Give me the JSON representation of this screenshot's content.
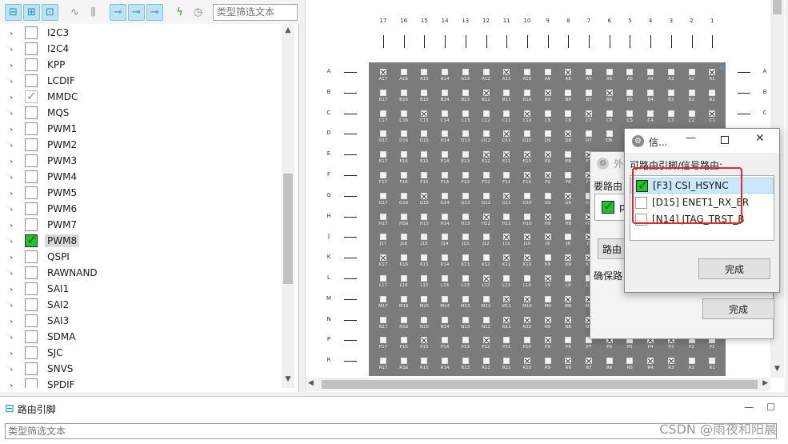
{
  "toolbar": {
    "filter_placeholder": "类型筛选文本",
    "icons": [
      "align-left-icon",
      "align-center-icon",
      "align-right-icon",
      "wave-icon",
      "signal-icon",
      "route-icon",
      "route-forward-icon",
      "route-next-icon",
      "bolt-icon",
      "clock-icon"
    ]
  },
  "peripherals": [
    {
      "label": "I2C3",
      "state": "none"
    },
    {
      "label": "I2C4",
      "state": "none"
    },
    {
      "label": "KPP",
      "state": "none"
    },
    {
      "label": "LCDIF",
      "state": "none"
    },
    {
      "label": "MMDC",
      "state": "gray"
    },
    {
      "label": "MQS",
      "state": "none"
    },
    {
      "label": "PWM1",
      "state": "none"
    },
    {
      "label": "PWM2",
      "state": "none"
    },
    {
      "label": "PWM3",
      "state": "none"
    },
    {
      "label": "PWM4",
      "state": "none"
    },
    {
      "label": "PWM5",
      "state": "none"
    },
    {
      "label": "PWM6",
      "state": "none"
    },
    {
      "label": "PWM7",
      "state": "none"
    },
    {
      "label": "PWM8",
      "state": "green",
      "selected": true
    },
    {
      "label": "QSPI",
      "state": "none"
    },
    {
      "label": "RAWNAND",
      "state": "none"
    },
    {
      "label": "SAI1",
      "state": "none"
    },
    {
      "label": "SAI2",
      "state": "none"
    },
    {
      "label": "SAI3",
      "state": "none"
    },
    {
      "label": "SDMA",
      "state": "none"
    },
    {
      "label": "SJC",
      "state": "none"
    },
    {
      "label": "SNVS",
      "state": "none"
    },
    {
      "label": "SPDIF",
      "state": "none"
    }
  ],
  "package": {
    "columns": [
      "17",
      "16",
      "15",
      "14",
      "13",
      "12",
      "11",
      "10",
      "9",
      "8",
      "7",
      "6",
      "5",
      "4",
      "3",
      "2",
      "1"
    ],
    "rows": [
      "A",
      "B",
      "C",
      "D",
      "E",
      "F",
      "G",
      "H",
      "J",
      "K",
      "L",
      "M",
      "N",
      "P",
      "R"
    ],
    "right_rows": [
      "A",
      "B",
      "C"
    ]
  },
  "bottom": {
    "tab_label": "路由引脚",
    "filter_placeholder": "类型筛选文本"
  },
  "dialog_back": {
    "title": "外",
    "label1": "要路由",
    "item_text": "pv",
    "button_label": "路由",
    "label2": "确保路",
    "done_label": "完成"
  },
  "dialog_front": {
    "title": "信...",
    "label": "可路由引脚/信号路由:",
    "items": [
      {
        "text": "[F3] CSI_HSYNC",
        "checked": true,
        "selected": true
      },
      {
        "text": "[D15] ENET1_RX_ER",
        "checked": false,
        "selected": false
      },
      {
        "text": "[N14] JTAG_TRST_B",
        "checked": false,
        "selected": false
      }
    ],
    "done_label": "完成"
  },
  "watermark": "CSDN @雨夜和阳晨"
}
